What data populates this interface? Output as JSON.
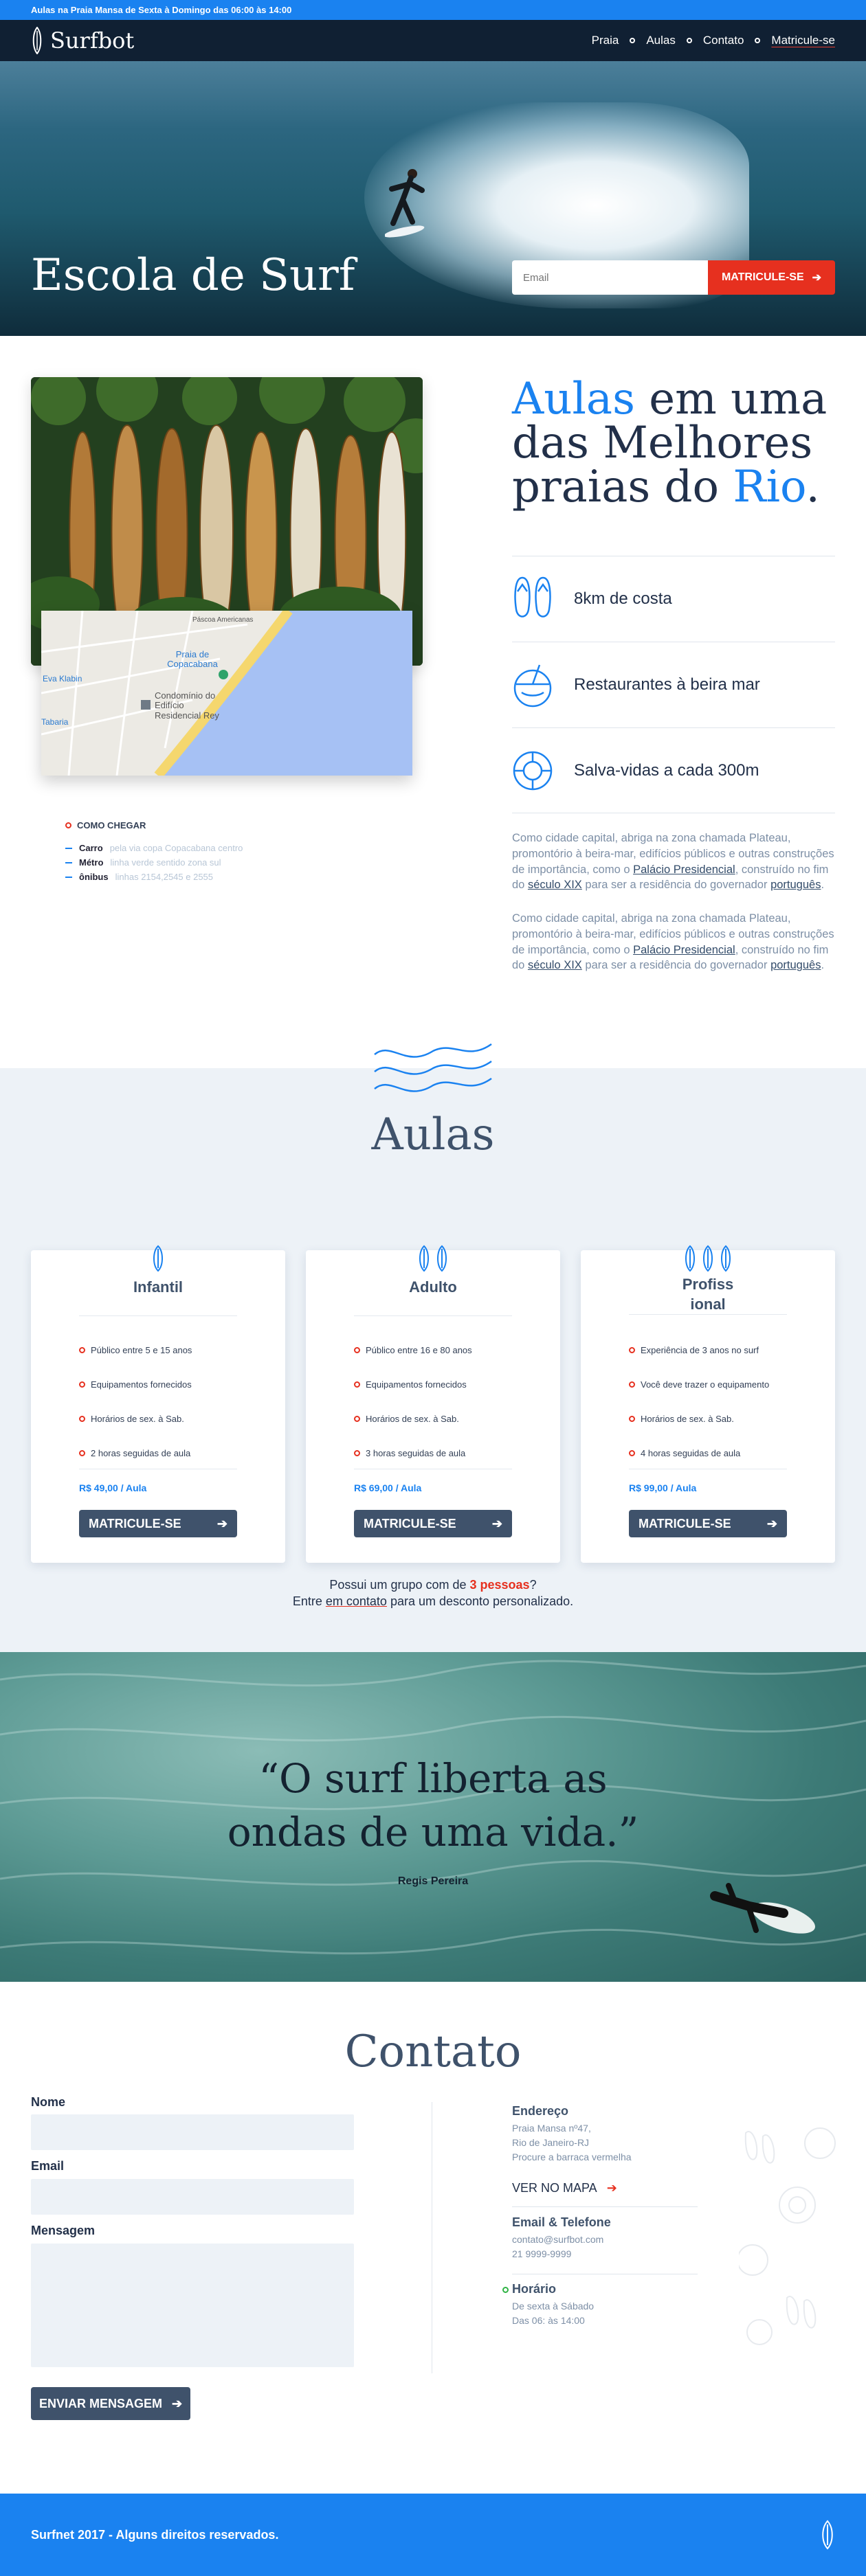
{
  "topbar": {
    "text": "Aulas na Praia Mansa de Sexta à Domingo das 06:00 às 14:00"
  },
  "nav": {
    "logo": "Surfbot",
    "items": [
      {
        "label": "Praia"
      },
      {
        "label": "Aulas"
      },
      {
        "label": "Contato"
      },
      {
        "label": "Matricule-se"
      }
    ]
  },
  "hero": {
    "title": "Escola de Surf",
    "email_placeholder": "Email",
    "cta": "MATRICULE-SE"
  },
  "about": {
    "heading_pre": "Aulas",
    "heading_mid": " em uma das Melhores praias do ",
    "heading_city": "Rio",
    "heading_end": ".",
    "features": [
      "8km de costa",
      "Restaurantes à beira mar",
      "Salva-vidas a cada 300m"
    ],
    "para_a": "Como cidade capital, abriga na zona chamada Plateau, promontório à beira-mar, edifícios públicos e outras construções de importância, como o ",
    "para_link1": "Palácio Presidencial",
    "para_b": ", construído no fim do ",
    "para_link2": "século XIX",
    "para_c": " para ser a residência do governador ",
    "para_link3": "português",
    "para_d": ".",
    "map_labels": {
      "praia": "Praia de Copacabana",
      "cond": "Condomínio do Edifício Residencial Rey",
      "pascoa": "Páscoa Americanas",
      "klabin": "Eva Klabin",
      "lapa": "Tabaria"
    },
    "directions": {
      "title": "COMO CHEGAR",
      "rows": [
        {
          "mode": "Carro",
          "desc": "pela via copa Copacabana centro"
        },
        {
          "mode": "Métro",
          "desc": "linha verde sentido zona sul"
        },
        {
          "mode": "ônibus",
          "desc": "linhas 2154,2545 e 2555"
        }
      ]
    }
  },
  "aulas": {
    "title": "Aulas",
    "cards": [
      {
        "name": "Infantil",
        "items": [
          "Público entre 5 e 15 anos",
          "Equipamentos fornecidos",
          "Horários de sex. à Sab.",
          "2 horas seguidas de aula"
        ],
        "price": "R$ 49,00 / Aula",
        "cta": "MATRICULE-SE",
        "boards": 1
      },
      {
        "name": "Adulto",
        "items": [
          "Público entre 16 e 80 anos",
          "Equipamentos fornecidos",
          "Horários de sex. à Sab.",
          "3 horas seguidas de aula"
        ],
        "price": "R$ 69,00 / Aula",
        "cta": "MATRICULE-SE",
        "boards": 2
      },
      {
        "name": "Profiss\nional",
        "items": [
          "Experiência de 3 anos no surf",
          "Você deve trazer o equipamento",
          "Horários de sex. à Sab.",
          "4 horas seguidas de aula"
        ],
        "price": "R$ 99,00 / Aula",
        "cta": "MATRICULE-SE",
        "boards": 3
      }
    ],
    "grupo_a": "Possui um grupo com de ",
    "grupo_b": "3 pessoas",
    "grupo_c": "?",
    "grupo_d": "Entre ",
    "grupo_link": "em contato",
    "grupo_e": " para um desconto personalizado."
  },
  "quote": {
    "text": "“O surf liberta as ondas de uma vida.”",
    "author": "Regis Pereira"
  },
  "contato": {
    "title": "Contato",
    "labels": {
      "nome": "Nome",
      "email": "Email",
      "mensagem": "Mensagem"
    },
    "send": "ENVIAR MENSAGEM",
    "endereco": {
      "title": "Endereço",
      "lines": [
        "Praia Mansa nº47,",
        "Rio de Janeiro-RJ",
        "Procure a barraca vermelha"
      ]
    },
    "mapa": "VER NO MAPA",
    "email_tel": {
      "title": "Email & Telefone",
      "lines": [
        "contato@surfbot.com",
        "21 9999-9999"
      ]
    },
    "horario": {
      "title": "Horário",
      "lines": [
        "De sexta à Sábado",
        "Das 06: às 14:00"
      ]
    }
  },
  "footer": {
    "text": "Surfnet 2017 - Alguns direitos reservados."
  },
  "colors": {
    "primary": "#1a82f0",
    "accent": "#e6301f",
    "dark": "#102033",
    "slate": "#3f526b"
  }
}
